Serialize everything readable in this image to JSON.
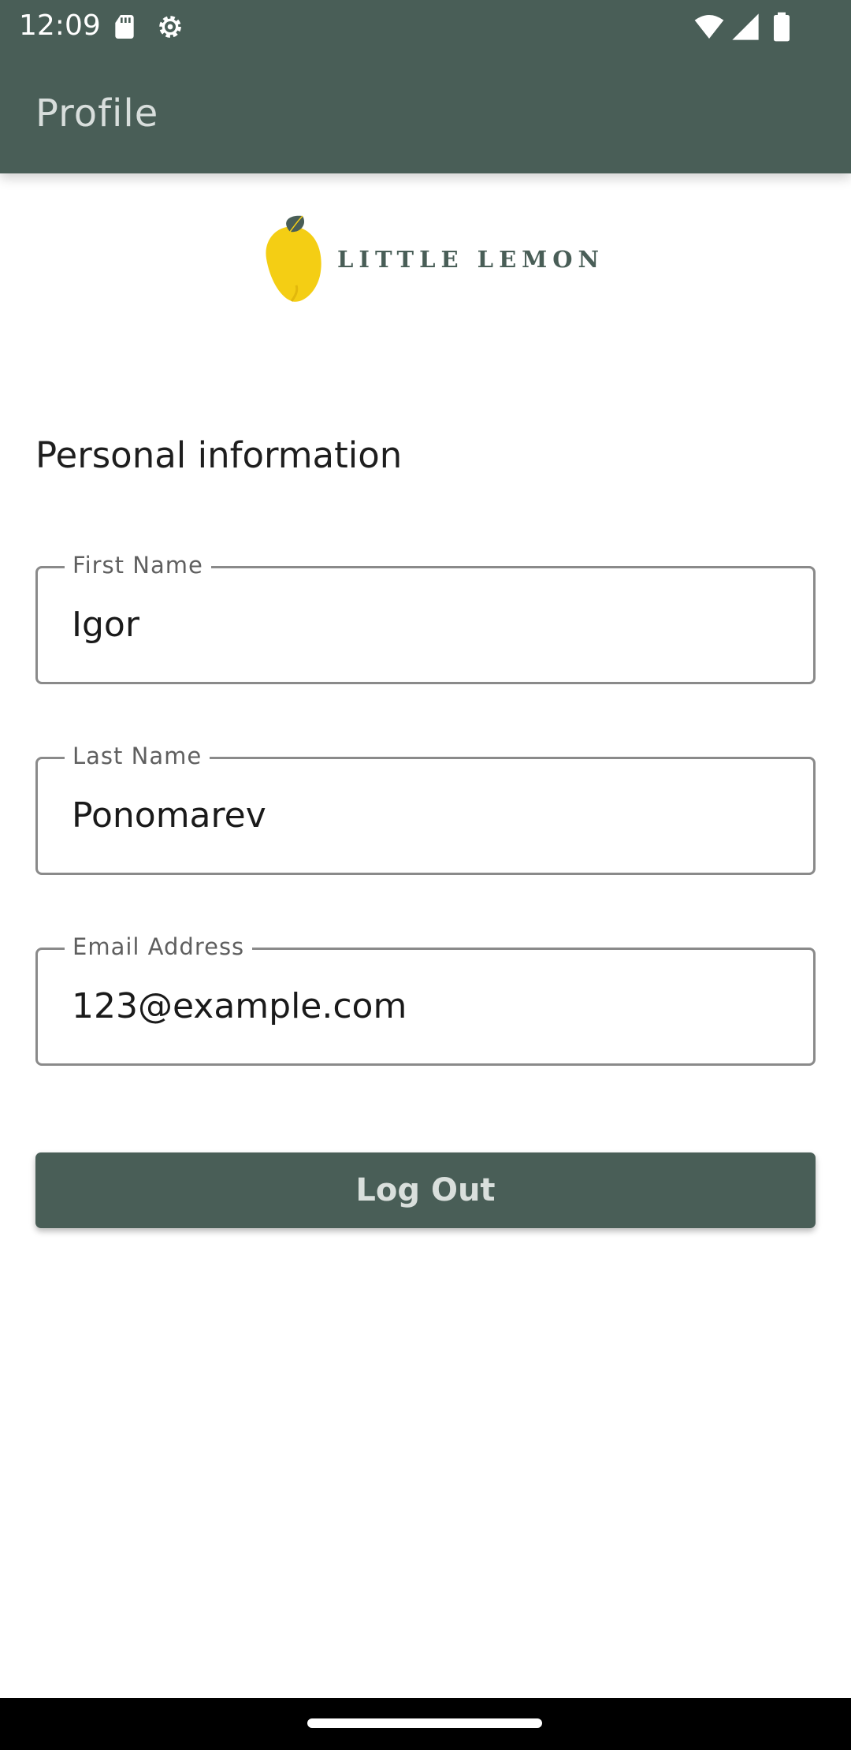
{
  "status_bar": {
    "time": "12:09",
    "icons": [
      "sd-card-icon",
      "settings-gear-icon",
      "wifi-icon",
      "cell-signal-icon",
      "battery-icon"
    ]
  },
  "app_bar": {
    "title": "Profile",
    "background_color": "#495e57"
  },
  "logo": {
    "brand_name": "LITTLE LEMON"
  },
  "section": {
    "title": "Personal information"
  },
  "fields": [
    {
      "label": "First Name",
      "value": "Igor"
    },
    {
      "label": "Last Name",
      "value": "Ponomarev"
    },
    {
      "label": "Email Address",
      "value": "123@example.com"
    }
  ],
  "logout_button": {
    "label": "Log Out",
    "color": "#495e57"
  },
  "nav": {
    "home_indicator": "home-indicator"
  }
}
